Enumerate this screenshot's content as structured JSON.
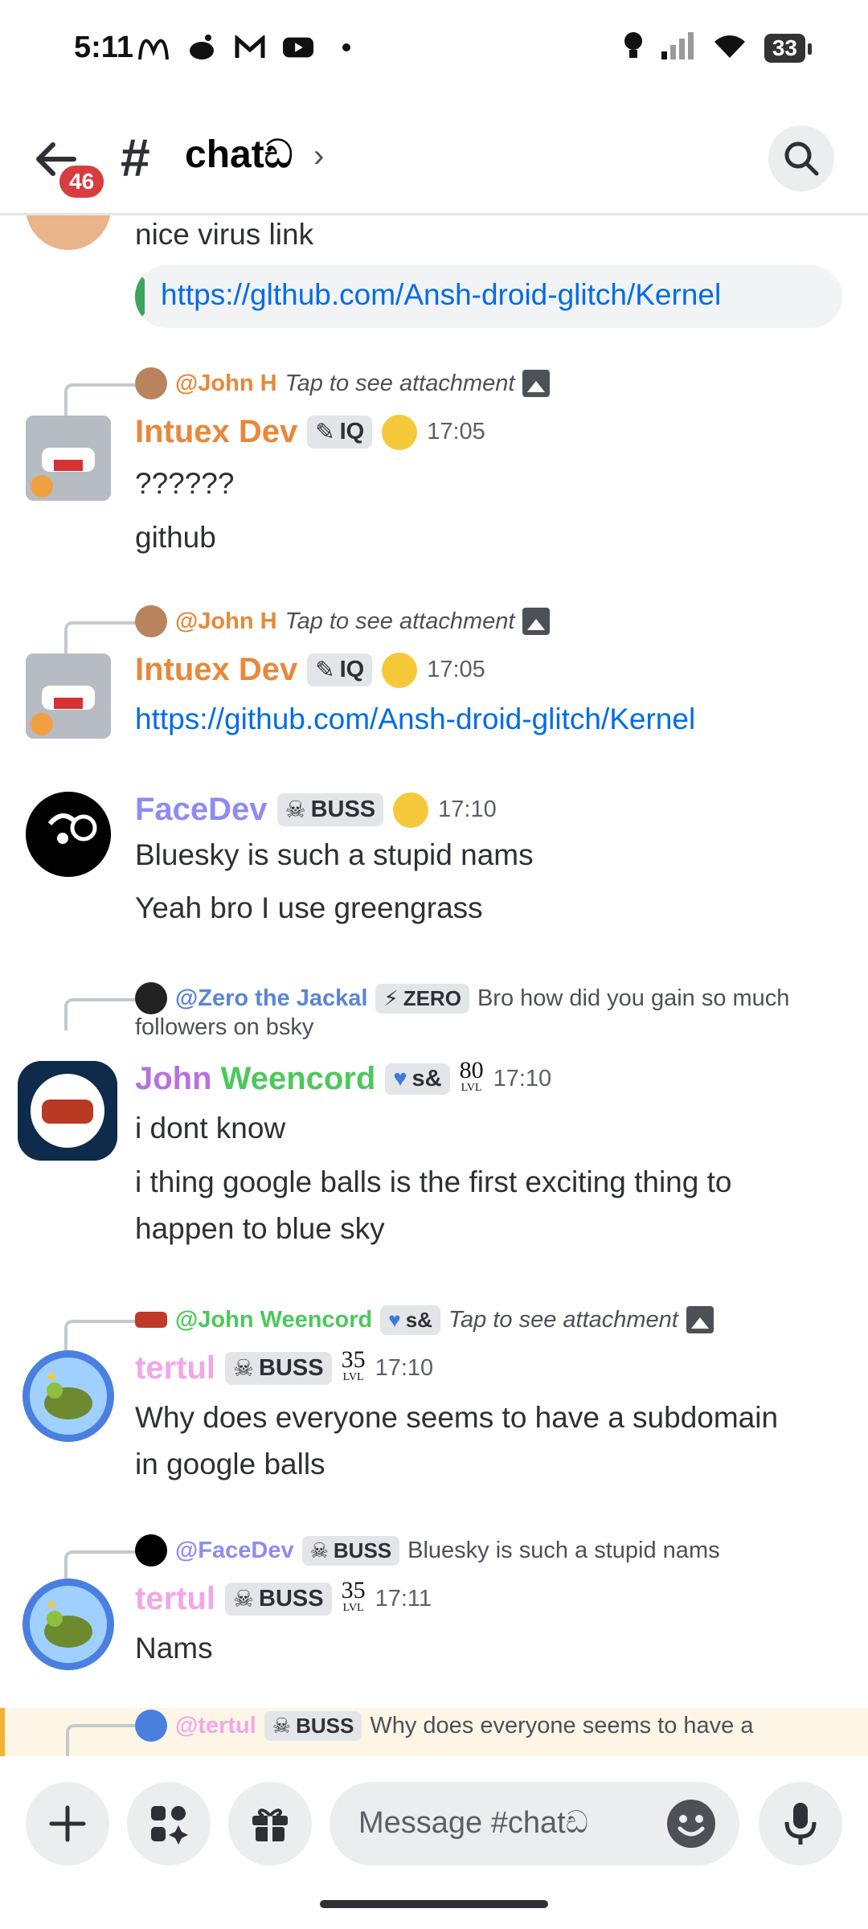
{
  "status_bar": {
    "time": "5:11",
    "battery": "33"
  },
  "header": {
    "badge_count": "46",
    "hash": "#",
    "channel_name": "chatඩ",
    "chevron": "›"
  },
  "messages": {
    "m0": {
      "text": "nice virus link",
      "embed_link": "https://glthub.com/Ansh-droid-glitch/Kernel"
    },
    "m1": {
      "reply_name": "@John H",
      "reply_text": "Tap to see attachment",
      "author": "Intuex Dev",
      "tag": "IQ",
      "time": "17:05",
      "lines": [
        "??????",
        "github"
      ]
    },
    "m2": {
      "reply_name": "@John H",
      "reply_text": "Tap to see attachment",
      "author": "Intuex Dev",
      "tag": "IQ",
      "time": "17:05",
      "link": "https://github.com/Ansh-droid-glitch/Kernel"
    },
    "m3": {
      "author": "FaceDev",
      "tag": "BUSS",
      "time": "17:10",
      "lines": [
        "Bluesky is such a stupid nams",
        "Yeah bro I use greengrass"
      ]
    },
    "m4": {
      "reply_name": "@Zero the Jackal",
      "reply_tag": "ZERO",
      "reply_text": "Bro how did you gain so much",
      "reply_text2": "followers on bsky",
      "author_a": "John ",
      "author_b": "Weencord",
      "tag": "s&",
      "level": "80",
      "level_sub": "LVL",
      "time": "17:10",
      "lines": [
        "i dont know",
        "i thing google balls is the first exciting thing to",
        "happen to blue sky"
      ]
    },
    "m5": {
      "reply_name": "@John Weencord",
      "reply_tag": "s&",
      "reply_text": "Tap to see attachment",
      "author": "tertul",
      "tag": "BUSS",
      "level": "35",
      "level_sub": "LVL",
      "time": "17:10",
      "lines": [
        "Why does everyone seems to have a subdomain",
        "in google balls"
      ]
    },
    "m6": {
      "reply_name": "@FaceDev",
      "reply_tag": "BUSS",
      "reply_text": "Bluesky is such a stupid nams",
      "author": "tertul",
      "tag": "BUSS",
      "level": "35",
      "level_sub": "LVL",
      "time": "17:11",
      "lines": [
        "Nams"
      ]
    },
    "m7": {
      "reply_name": "@tertul",
      "reply_tag": "BUSS",
      "reply_text": "Why does everyone seems to have a"
    }
  },
  "composer": {
    "placeholder": "Message #chatඩ"
  },
  "colors": {
    "accent_orange": "#e8883a",
    "facedev": "#8e8cf0",
    "john_purple": "#b673e0",
    "john_green": "#4cc85c",
    "tertul_pink": "#f3a6e6",
    "link": "#006ce7",
    "badge_red": "#d83c3e"
  }
}
